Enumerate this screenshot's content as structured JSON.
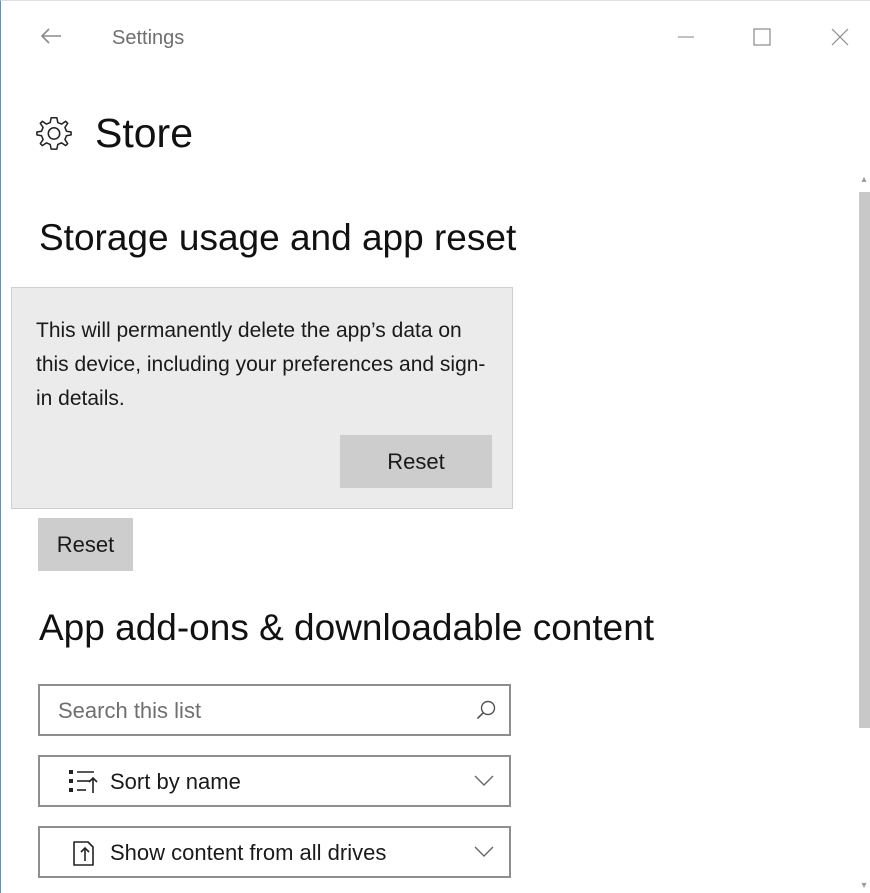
{
  "window": {
    "title": "Settings"
  },
  "page": {
    "title": "Store"
  },
  "storage": {
    "heading": "Storage usage and app reset",
    "flyout_message": "This will permanently delete the app’s data on this device, including your preferences and sign-in details.",
    "flyout_button": "Reset",
    "reset_button": "Reset"
  },
  "addons": {
    "heading": "App add-ons & downloadable content",
    "search_placeholder": "Search this list",
    "sort_selected": "Sort by name",
    "drives_selected": "Show content from all drives"
  },
  "icons": {
    "back": "back-arrow-icon",
    "minimize": "minimize-icon",
    "maximize": "maximize-icon",
    "close": "close-icon",
    "page": "gear-icon",
    "search": "search-icon",
    "sort": "sort-list-icon",
    "drives": "drive-filter-icon",
    "dropdown": "chevron-down-icon"
  }
}
